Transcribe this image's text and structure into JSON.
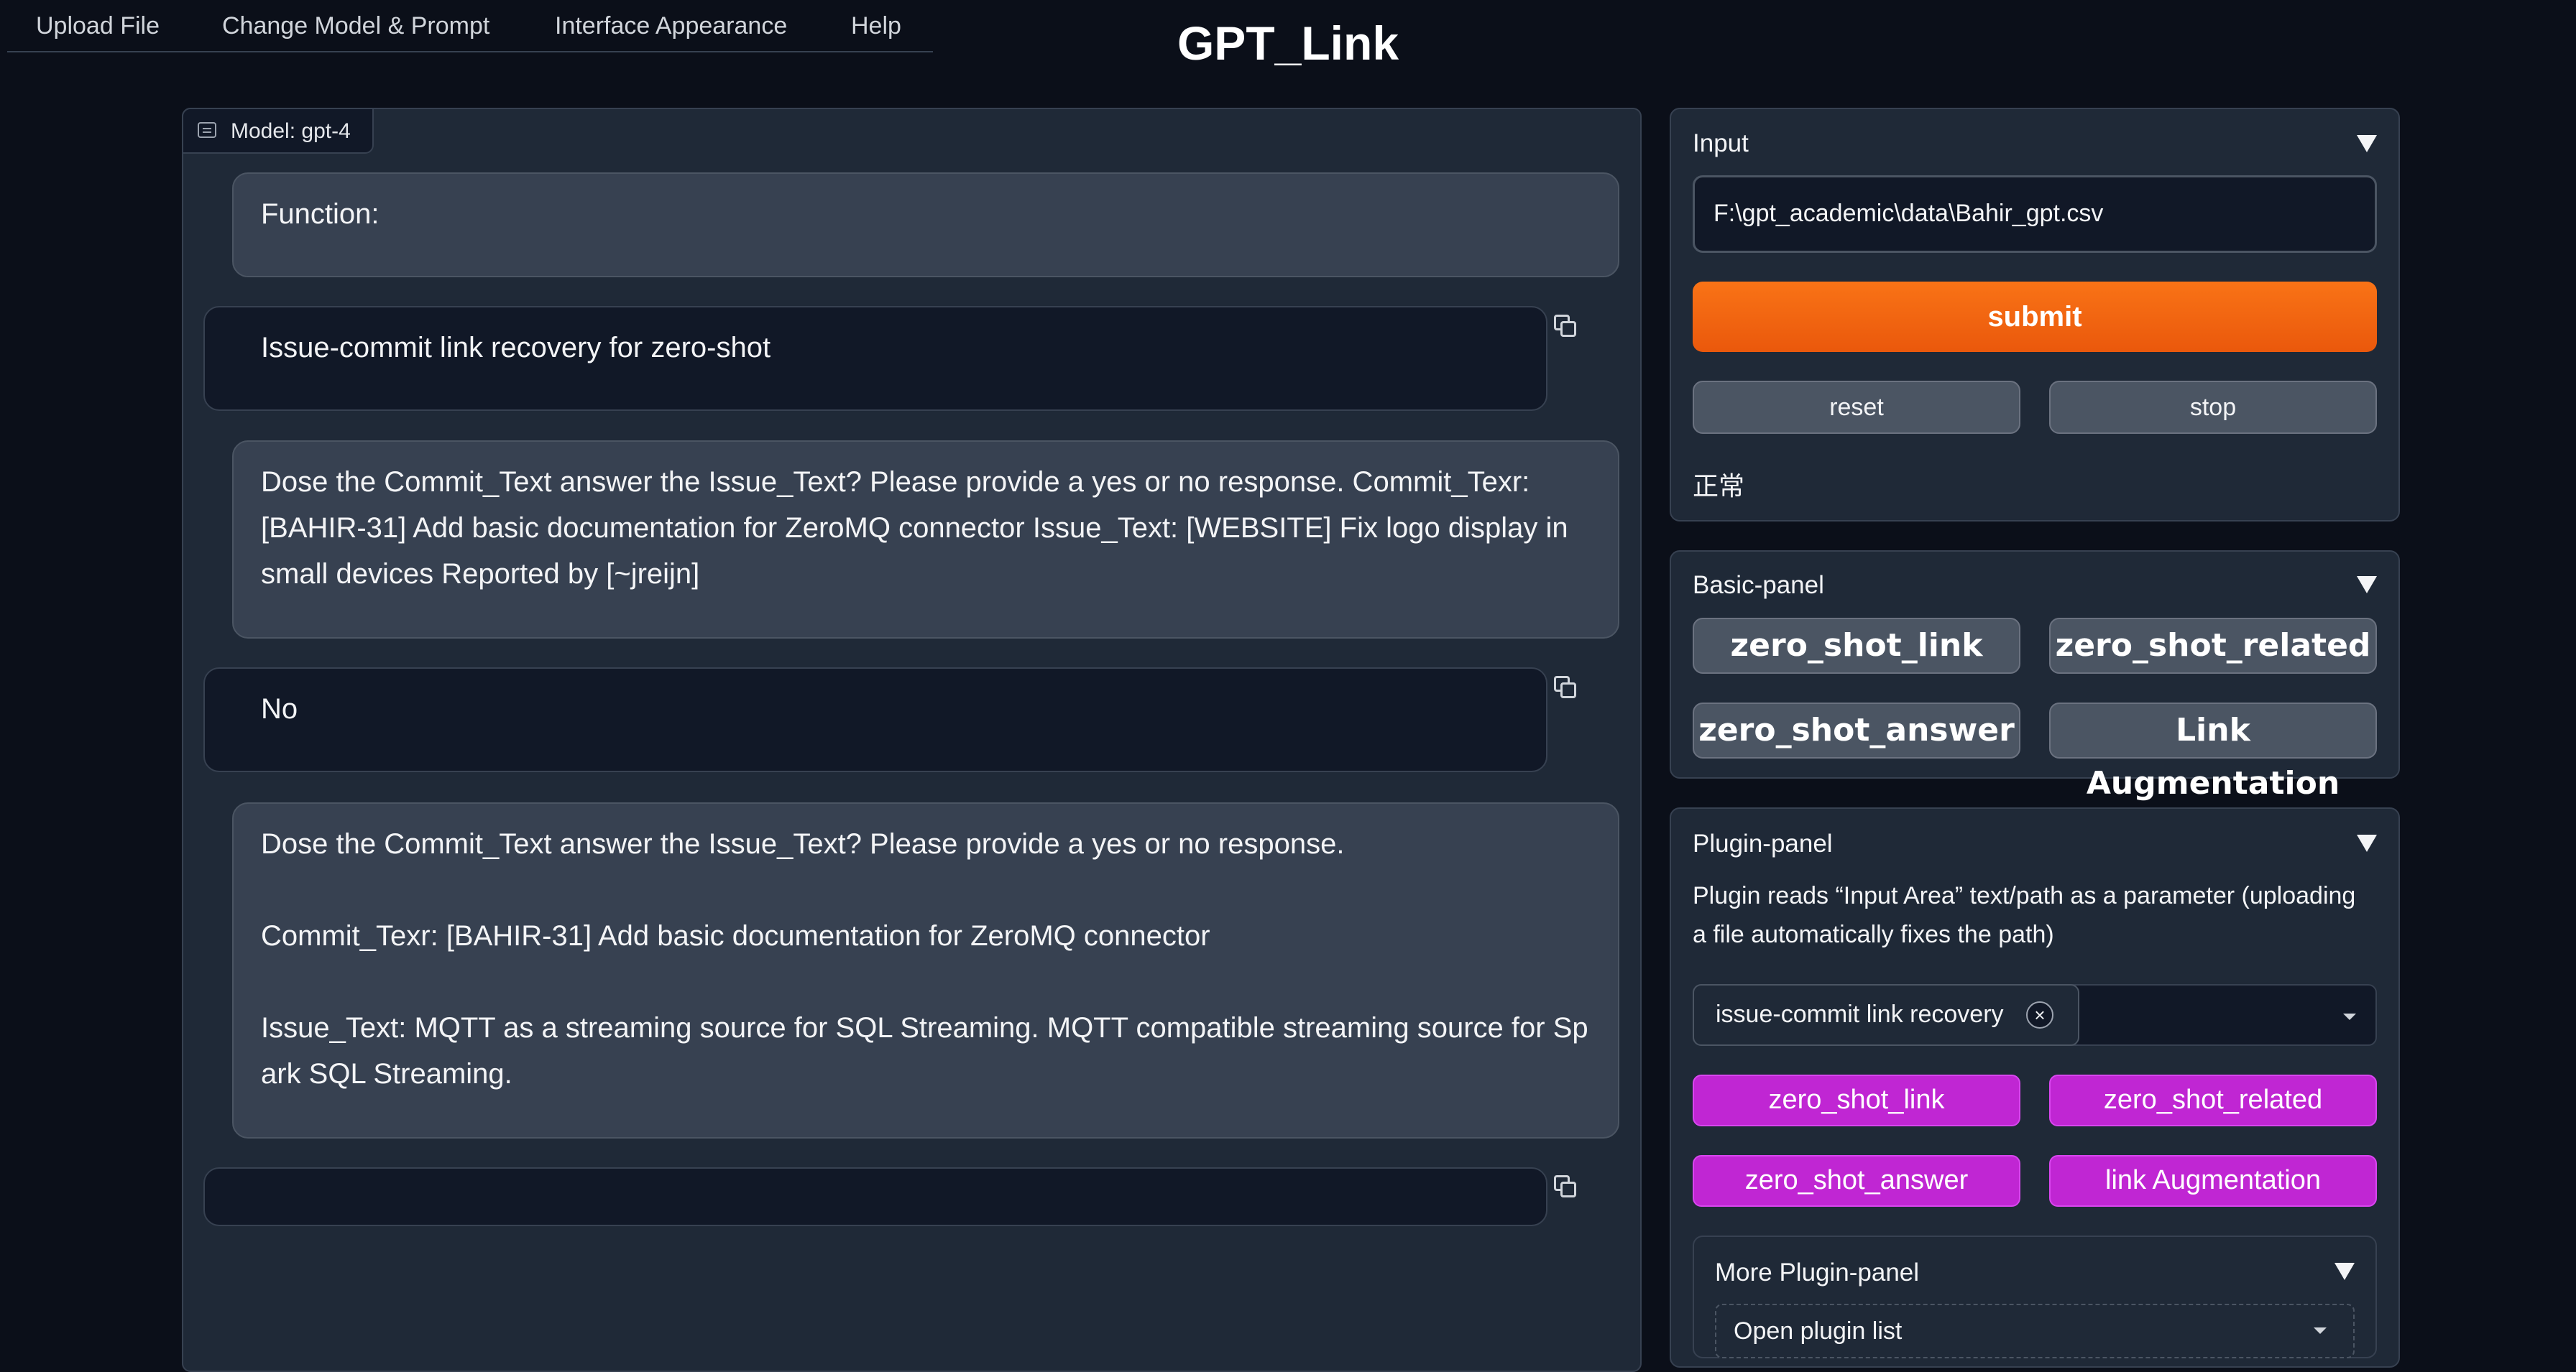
{
  "nav": {
    "tabs": [
      "Upload File",
      "Change Model & Prompt",
      "Interface Appearance",
      "Help"
    ]
  },
  "page": {
    "title": "GPT_Link"
  },
  "chat": {
    "model_label": "Model: gpt-4",
    "messages": [
      {
        "role": "user",
        "text": "Function:"
      },
      {
        "role": "bot",
        "text": "Issue-commit link recovery for zero-shot"
      },
      {
        "role": "user",
        "text": "Dose the Commit_Text answer the Issue_Text? Please provide a yes or no response. Commit_Texr: [BAHIR-31] Add basic documentation for ZeroMQ connector Issue_Text: [WEBSITE] Fix logo display in small devices Reported by [~jreijn]"
      },
      {
        "role": "bot",
        "text": "No"
      },
      {
        "role": "user",
        "paragraphs": [
          "Dose the Commit_Text answer the Issue_Text? Please provide a yes or no response.",
          "Commit_Texr: [BAHIR-31] Add basic documentation for ZeroMQ connector",
          "Issue_Text: MQTT as a streaming source for SQL Streaming. MQTT compatible streaming source for Sp ark SQL Streaming."
        ]
      },
      {
        "role": "bot",
        "text": ""
      }
    ]
  },
  "input_panel": {
    "title": "Input",
    "value": "F:\\gpt_academic\\data\\Bahir_gpt.csv",
    "submit_label": "submit",
    "reset_label": "reset",
    "stop_label": "stop",
    "status": "正常"
  },
  "basic_panel": {
    "title": "Basic-panel",
    "buttons": [
      "zero_shot_link",
      "zero_shot_related",
      "zero_shot_answer",
      "Link Augmentation"
    ]
  },
  "plugin_panel": {
    "title": "Plugin-panel",
    "description": "Plugin reads “Input Area” text/path as a parameter (uploading a file automatically fixes the path)",
    "selected_chip": "issue-commit link recovery",
    "chip_close": "×",
    "buttons": [
      "zero_shot_link",
      "zero_shot_related",
      "zero_shot_answer",
      "link Augmentation"
    ],
    "more_title": "More Plugin-panel",
    "more_dropdown": "Open plugin list"
  },
  "colors": {
    "background": "#0b0f19",
    "submit": "#ea580c",
    "plugin_button": "#c026d3"
  }
}
